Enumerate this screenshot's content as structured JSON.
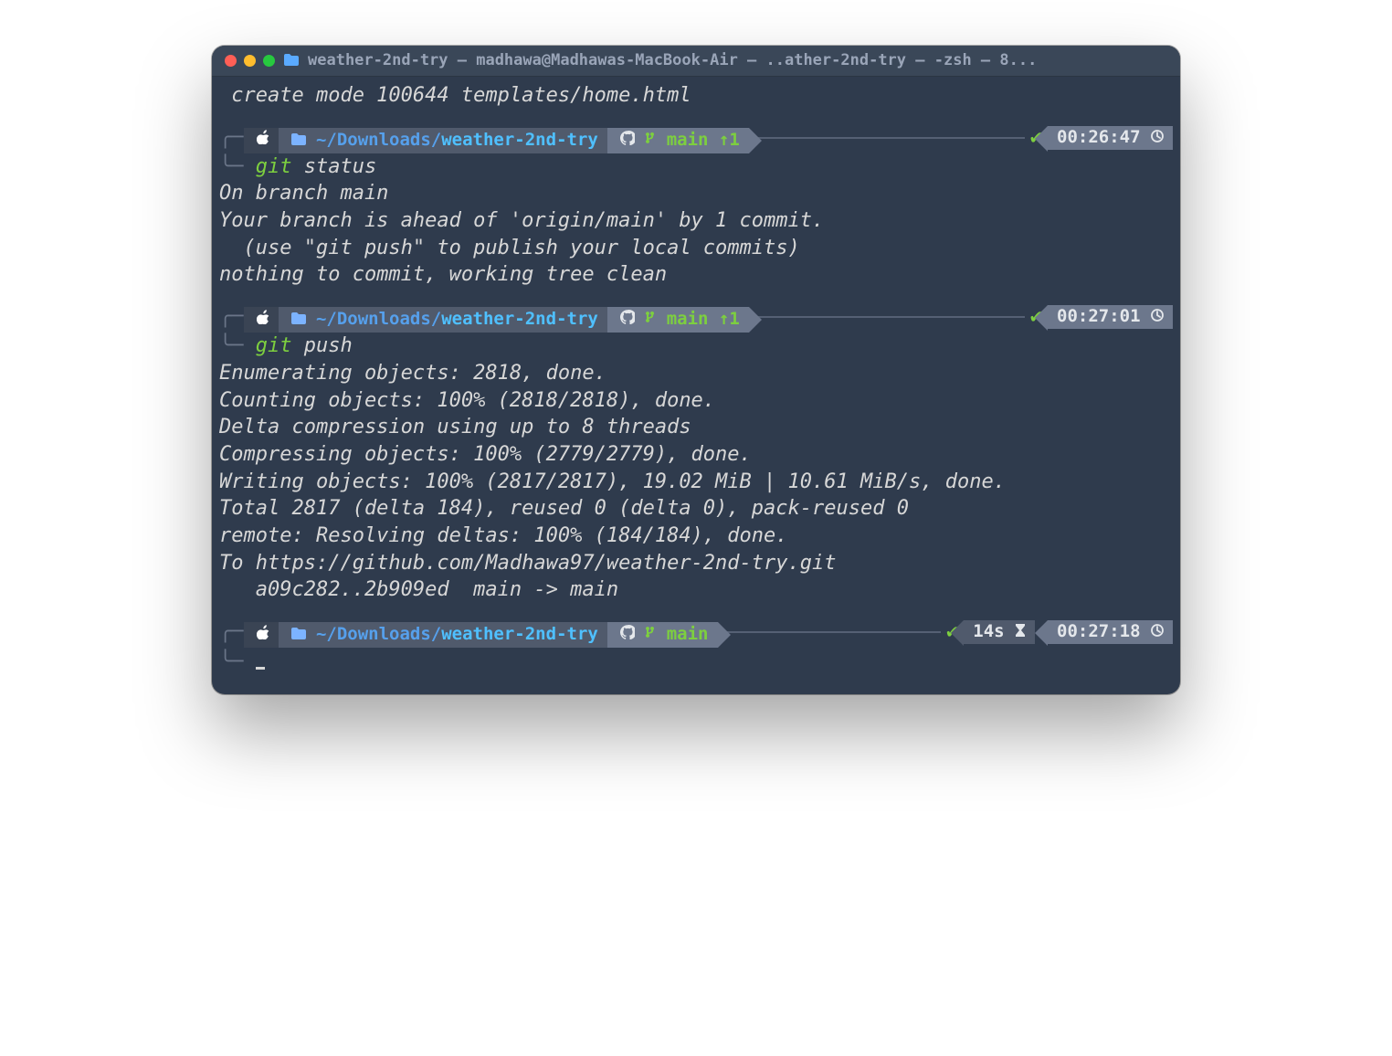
{
  "titlebar": {
    "title": "weather-2nd-try — madhawa@Madhawas-MacBook-Air — ..ather-2nd-try — -zsh — 8..."
  },
  "scrollback_top": " create mode 100644 templates/home.html",
  "prompts": [
    {
      "path_prefix": "~/Downloads/",
      "path_name": "weather-2nd-try",
      "branch": "main",
      "ahead": "↑1",
      "check": "✔",
      "duration": "",
      "time": "00:26:47",
      "command_kw": "git",
      "command_rest": " status",
      "output": [
        "On branch main",
        "Your branch is ahead of 'origin/main' by 1 commit.",
        "  (use \"git push\" to publish your local commits)",
        "",
        "nothing to commit, working tree clean"
      ]
    },
    {
      "path_prefix": "~/Downloads/",
      "path_name": "weather-2nd-try",
      "branch": "main",
      "ahead": "↑1",
      "check": "✔",
      "duration": "",
      "time": "00:27:01",
      "command_kw": "git",
      "command_rest": " push",
      "output": [
        "Enumerating objects: 2818, done.",
        "Counting objects: 100% (2818/2818), done.",
        "Delta compression using up to 8 threads",
        "Compressing objects: 100% (2779/2779), done.",
        "Writing objects: 100% (2817/2817), 19.02 MiB | 10.61 MiB/s, done.",
        "Total 2817 (delta 184), reused 0 (delta 0), pack-reused 0",
        "remote: Resolving deltas: 100% (184/184), done.",
        "To https://github.com/Madhawa97/weather-2nd-try.git",
        "   a09c282..2b909ed  main -> main"
      ]
    },
    {
      "path_prefix": "~/Downloads/",
      "path_name": "weather-2nd-try",
      "branch": "main",
      "ahead": "",
      "check": "✔",
      "duration": "14s",
      "time": "00:27:18",
      "command_kw": "",
      "command_rest": "",
      "output": []
    }
  ],
  "icons": {
    "apple": "apple-icon",
    "folder": "folder-icon",
    "github": "github-icon",
    "branch": "branch-icon",
    "clock": "clock-icon",
    "hourglass": "hourglass-icon"
  }
}
